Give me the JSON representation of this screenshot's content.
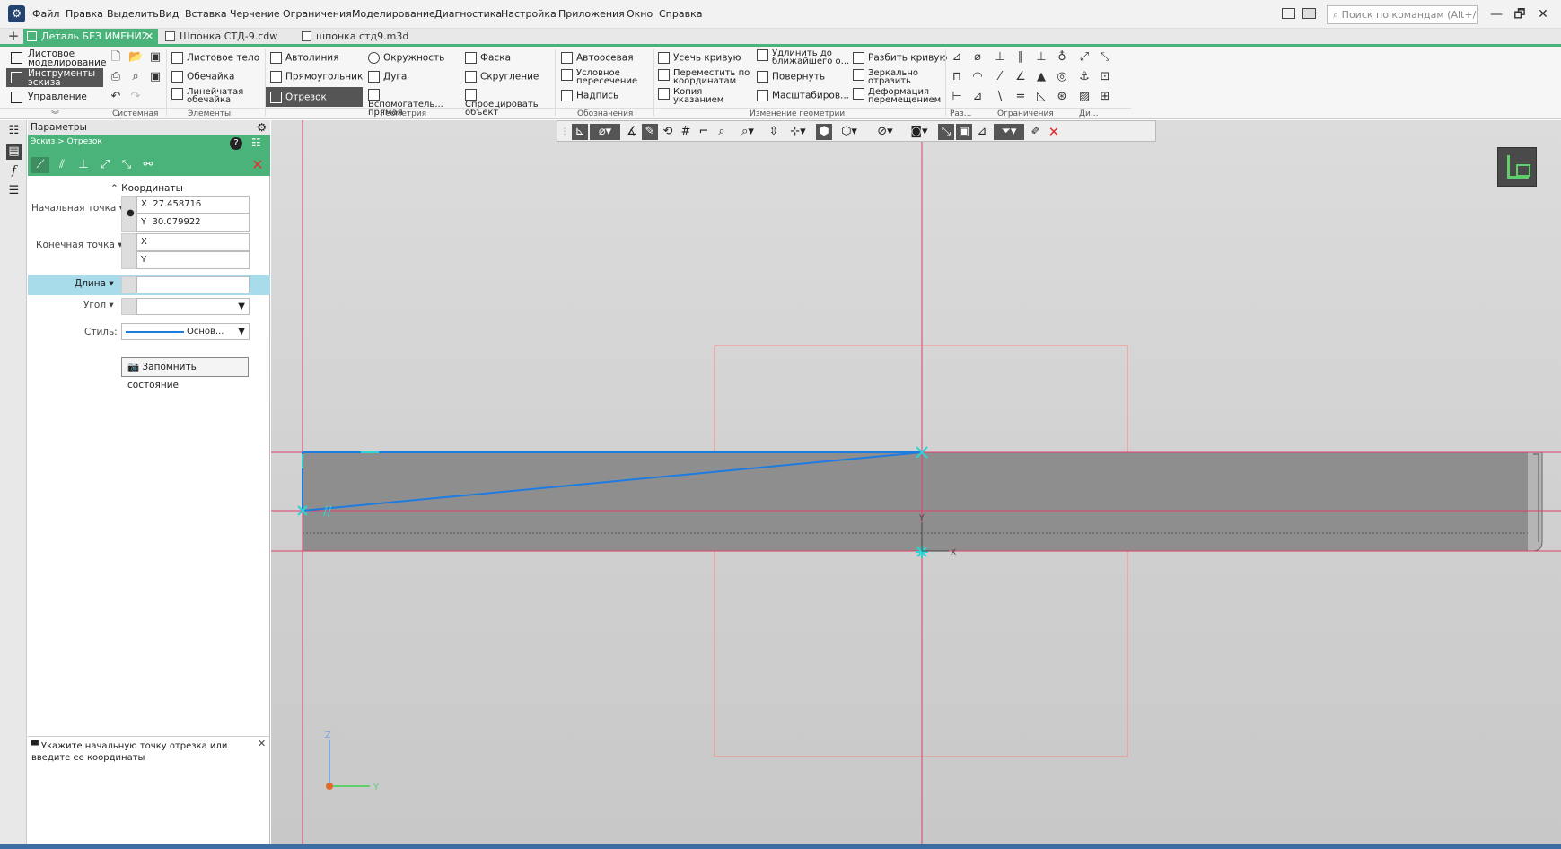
{
  "app": {
    "logo_glyph": "⚙"
  },
  "menu": [
    "Файл",
    "Правка",
    "Выделить",
    "Вид",
    "Вставка",
    "Черчение",
    "Ограничения",
    "Моделирование",
    "Диагностика",
    "Настройка",
    "Приложения",
    "Окно",
    "Справка"
  ],
  "search": {
    "placeholder": "Поиск по командам (Alt+/)"
  },
  "window_buttons": {
    "minimize": "—",
    "restore": "🗗",
    "close": "✕"
  },
  "tabs": {
    "new_tab": "+",
    "items": [
      {
        "label": "Деталь БЕЗ ИМЕНИ2",
        "close": "✕"
      },
      {
        "label": "Шпонка СТД-9.cdw"
      },
      {
        "label": "шпонка стд9.m3d"
      }
    ]
  },
  "modes": [
    "Листовое моделирование",
    "Инструменты эскиза",
    "Управление"
  ],
  "ribbon": {
    "elements": [
      "Листовое тело",
      "Обечайка",
      "Линейчатая обечайка"
    ],
    "geometry": [
      [
        "Автолиния",
        "Окружность",
        "Фаска"
      ],
      [
        "Прямоугольник",
        "Дуга",
        "Скругление"
      ],
      [
        "Отрезок",
        "Вспомогатель... прямая",
        "Спроецировать объект"
      ]
    ],
    "designations": [
      "Автоосевая",
      "Условное пересечение",
      "Надпись"
    ],
    "edit_geometry": [
      [
        "Усечь кривую",
        "Удлинить до ближайшего о...",
        "Разбить кривую"
      ],
      [
        "Переместить по координатам",
        "Повернуть",
        "Зеркально отразить"
      ],
      [
        "Копия указанием",
        "Масштабиров...",
        "Деформация перемещением"
      ]
    ],
    "group_labels": {
      "system": "Системная",
      "elements": "Элементы",
      "geometry": "Геометрия",
      "designations": "Обозначения",
      "edit_geometry": "Изменение геометрии",
      "raz": "Раз...",
      "constraints": "Ограничения",
      "di": "Ди..."
    }
  },
  "panel": {
    "title": "Параметры",
    "breadcrumb": "Эскиз > Отрезок",
    "section": "Координаты",
    "start_point": {
      "label": "Начальная точка",
      "x_label": "X",
      "x": "27.458716",
      "y_label": "Y",
      "y": "30.079922"
    },
    "end_point": {
      "label": "Конечная точка",
      "x_label": "X",
      "x": "",
      "y_label": "Y",
      "y": ""
    },
    "length_label": "Длина",
    "angle_label": "Угол",
    "style_label": "Стиль:",
    "style_value": "Основ...",
    "remember_button": "Запомнить состояние",
    "hint": "Укажите начальную точку отрезка или введите ее координаты"
  },
  "axis_labels": {
    "z": "Z",
    "y": "Y",
    "sketch_y": "Y",
    "sketch_x": "X"
  },
  "colors": {
    "accent_green": "#4ab37a",
    "selection_blue": "#1e7be0",
    "red_cross": "#e03030",
    "canvas_gray": "#d6d6d6"
  }
}
